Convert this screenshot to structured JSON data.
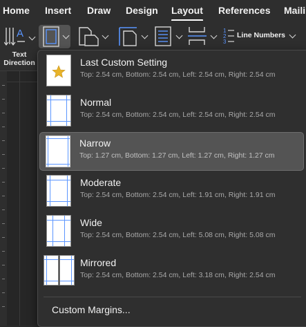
{
  "ribbon": {
    "tabs": [
      {
        "label": "Home",
        "active": false
      },
      {
        "label": "Insert",
        "active": false
      },
      {
        "label": "Draw",
        "active": false
      },
      {
        "label": "Design",
        "active": false
      },
      {
        "label": "Layout",
        "active": true
      },
      {
        "label": "References",
        "active": false
      },
      {
        "label": "Maili",
        "active": false
      }
    ]
  },
  "toolbar": {
    "text_direction_label": "Text\nDirection",
    "line_numbers_label": "Line Numbers"
  },
  "margins_menu": {
    "items": [
      {
        "title": "Last Custom Setting",
        "detail": "Top: 2.54 cm, Bottom: 2.54 cm, Left: 2.54 cm, Right: 2.54 cm",
        "icon": "star-page-icon",
        "selected": false
      },
      {
        "title": "Normal",
        "detail": "Top: 2.54 cm, Bottom: 2.54 cm, Left: 2.54 cm, Right: 2.54 cm",
        "icon": "normal-margins-icon",
        "selected": false
      },
      {
        "title": "Narrow",
        "detail": "Top: 1.27 cm, Bottom: 1.27 cm, Left: 1.27 cm, Right: 1.27 cm",
        "icon": "narrow-margins-icon",
        "selected": true
      },
      {
        "title": "Moderate",
        "detail": "Top: 2.54 cm, Bottom: 2.54 cm, Left: 1.91 cm, Right: 1.91 cm",
        "icon": "moderate-margins-icon",
        "selected": false
      },
      {
        "title": "Wide",
        "detail": "Top: 2.54 cm, Bottom: 2.54 cm, Left: 5.08 cm, Right: 5.08 cm",
        "icon": "wide-margins-icon",
        "selected": false
      },
      {
        "title": "Mirrored",
        "detail": "Top: 2.54 cm, Bottom: 2.54 cm, Left: 3.18 cm, Right: 2.54 cm",
        "icon": "mirrored-margins-icon",
        "selected": false
      }
    ],
    "custom_label": "Custom Margins..."
  },
  "colors": {
    "accent": "#5a95ff",
    "menu_bg": "#2f2f2f",
    "selected_bg": "#545454"
  }
}
